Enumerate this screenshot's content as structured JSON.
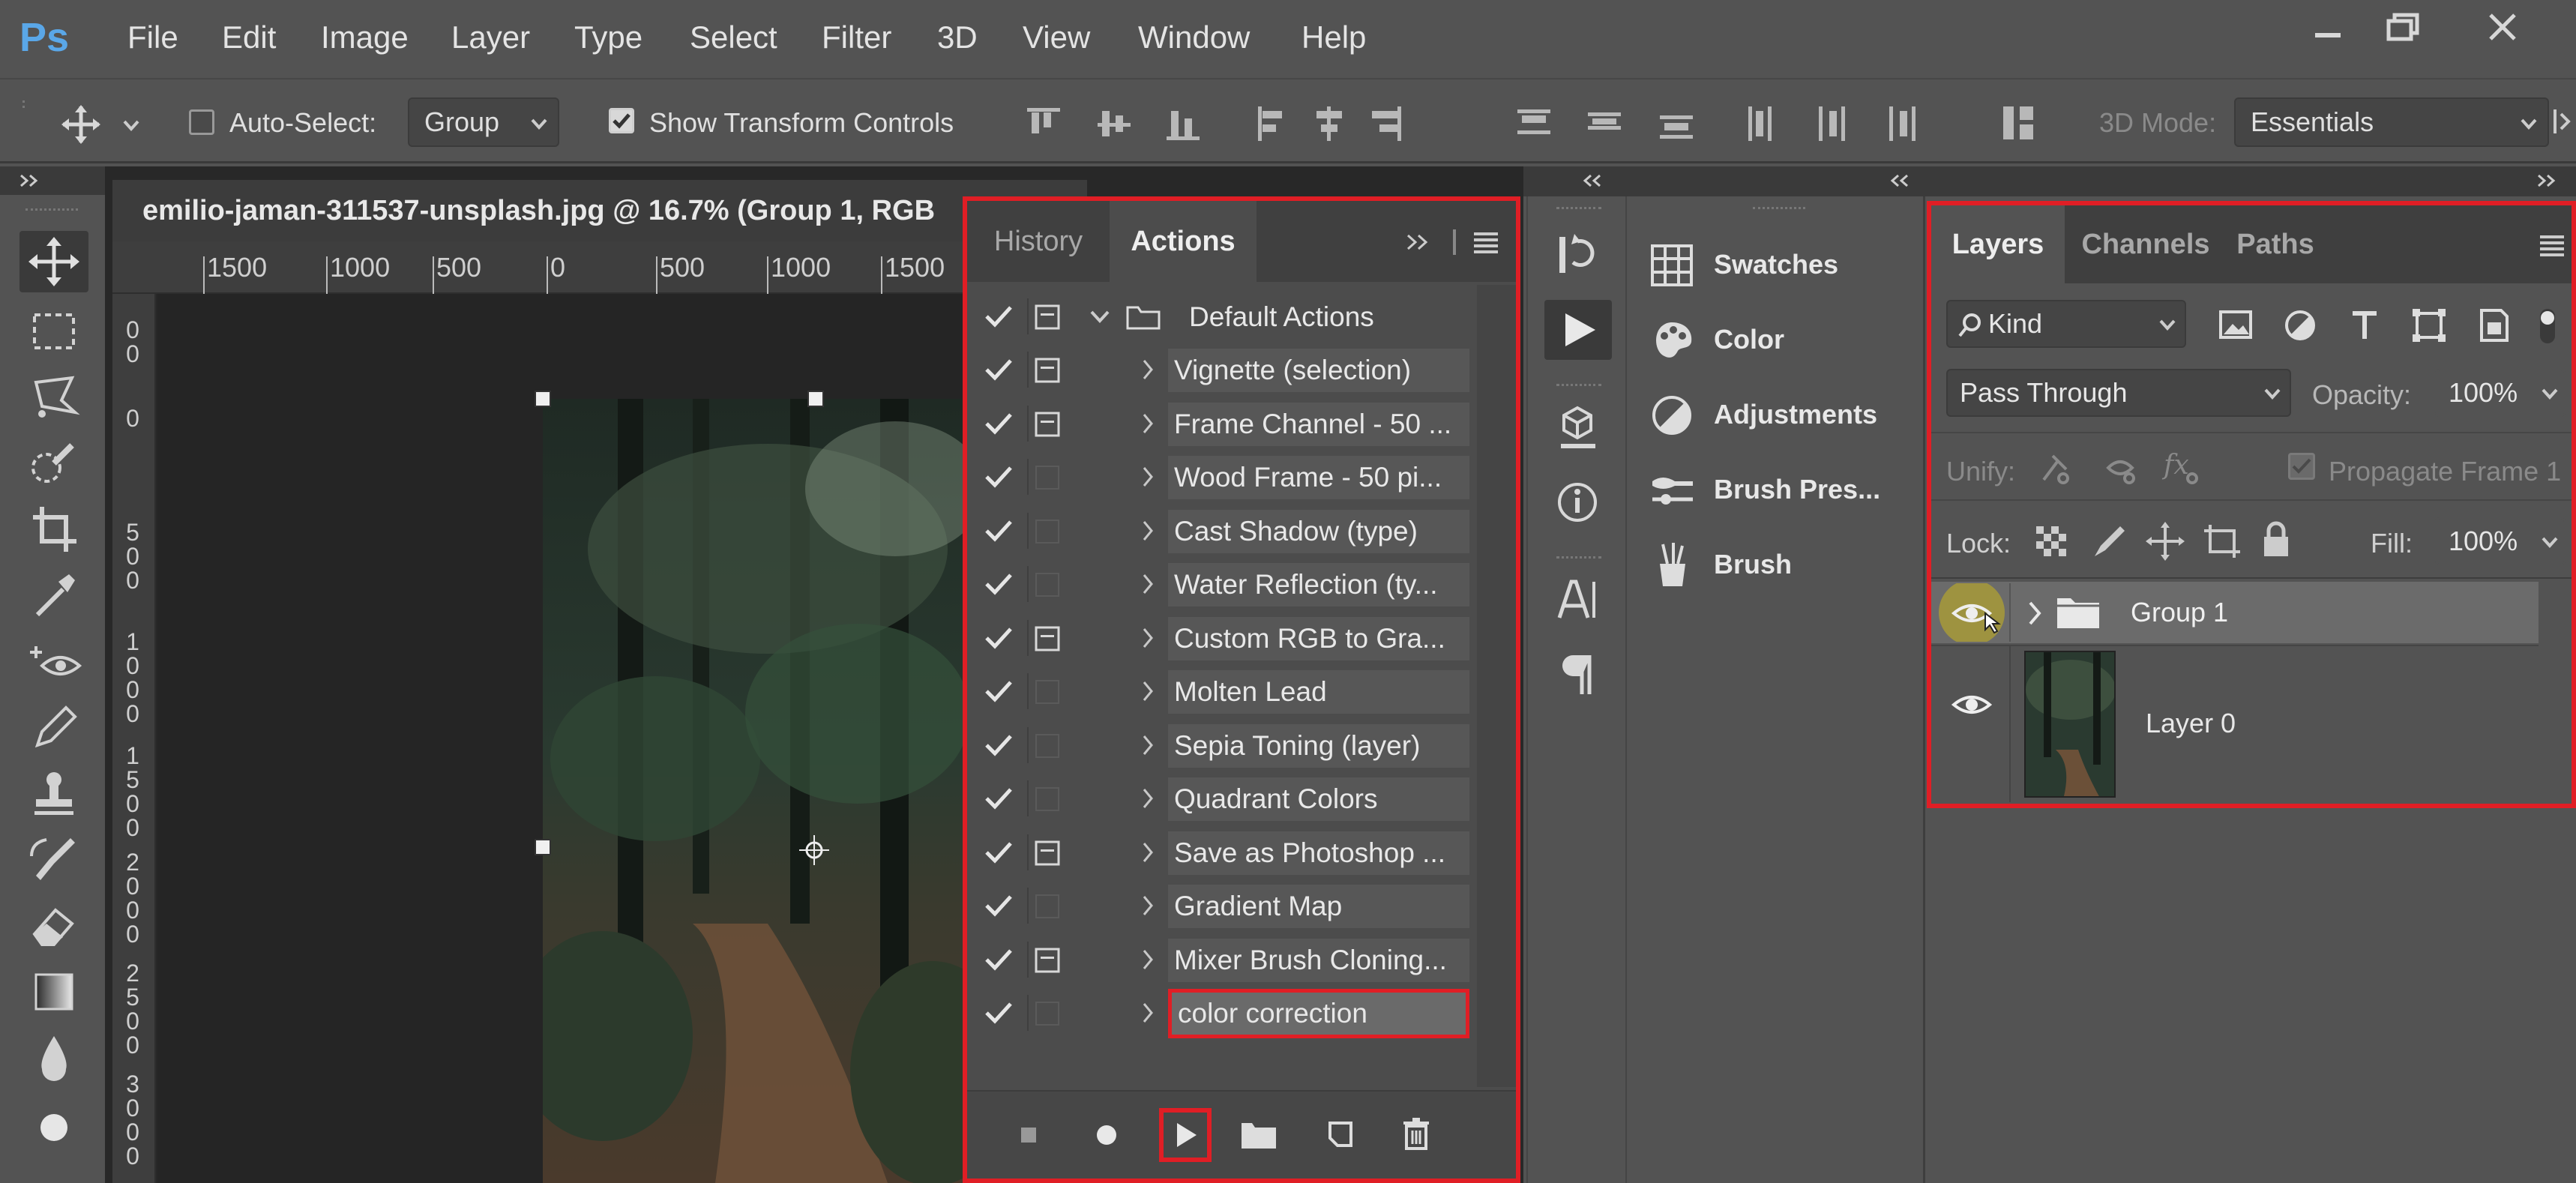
{
  "app": {
    "logo": "Ps",
    "menu": [
      "File",
      "Edit",
      "Image",
      "Layer",
      "Type",
      "Select",
      "Filter",
      "3D",
      "View",
      "Window",
      "Help"
    ]
  },
  "options": {
    "auto_select_label": "Auto-Select:",
    "auto_select_checked": false,
    "auto_select_mode": "Group",
    "show_transform_label": "Show Transform Controls",
    "show_transform_checked": true,
    "mode_3d_label": "3D Mode:",
    "workspace": "Essentials"
  },
  "document": {
    "tab_title": "emilio-jaman-311537-unsplash.jpg @ 16.7% (Group 1, RGB",
    "ruler_h": [
      "1500",
      "1000",
      "500",
      "0",
      "500",
      "1000",
      "1500"
    ],
    "ruler_v": [
      [
        "0",
        "0"
      ],
      [
        "0"
      ],
      [
        "5",
        "0",
        "0"
      ],
      [
        "1",
        "0",
        "0",
        "0"
      ],
      [
        "1",
        "5",
        "0",
        "0"
      ],
      [
        "2",
        "0",
        "0",
        "0"
      ],
      [
        "2",
        "5",
        "0",
        "0"
      ],
      [
        "3",
        "0",
        "0",
        "0"
      ]
    ]
  },
  "actions_panel": {
    "tabs": [
      "History",
      "Actions"
    ],
    "active_tab": "Actions",
    "set_name": "Default Actions",
    "actions": [
      {
        "label": "Vignette (selection)",
        "dialog": true
      },
      {
        "label": "Frame Channel - 50 ...",
        "dialog": true
      },
      {
        "label": "Wood Frame - 50 pi...",
        "dialog": false
      },
      {
        "label": "Cast Shadow (type)",
        "dialog": false
      },
      {
        "label": "Water Reflection (ty...",
        "dialog": false
      },
      {
        "label": "Custom RGB to Gra...",
        "dialog": true
      },
      {
        "label": "Molten Lead",
        "dialog": false
      },
      {
        "label": "Sepia Toning (layer)",
        "dialog": false
      },
      {
        "label": "Quadrant Colors",
        "dialog": false
      },
      {
        "label": "Save as Photoshop ...",
        "dialog": true
      },
      {
        "label": "Gradient Map",
        "dialog": false
      },
      {
        "label": "Mixer Brush Cloning...",
        "dialog": true
      },
      {
        "label": "color correction",
        "dialog": false,
        "selected": true
      }
    ]
  },
  "mid_panel": {
    "items": [
      "Swatches",
      "Color",
      "Adjustments",
      "Brush Pres...",
      "Brush"
    ]
  },
  "layers_panel": {
    "tabs": [
      "Layers",
      "Channels",
      "Paths"
    ],
    "active_tab": "Layers",
    "filter_kind": "Kind",
    "blend_mode": "Pass Through",
    "opacity_label": "Opacity:",
    "opacity": "100%",
    "unify_label": "Unify:",
    "propagate_label": "Propagate Frame 1",
    "lock_label": "Lock:",
    "fill_label": "Fill:",
    "fill": "100%",
    "layers": [
      {
        "name": "Group 1",
        "type": "group",
        "visible": true,
        "selected": true
      },
      {
        "name": "Layer 0",
        "type": "pixel",
        "visible": true,
        "selected": false
      }
    ]
  },
  "colors": {
    "highlight": "#e01e25",
    "ps_blue": "#5aa7e8"
  }
}
